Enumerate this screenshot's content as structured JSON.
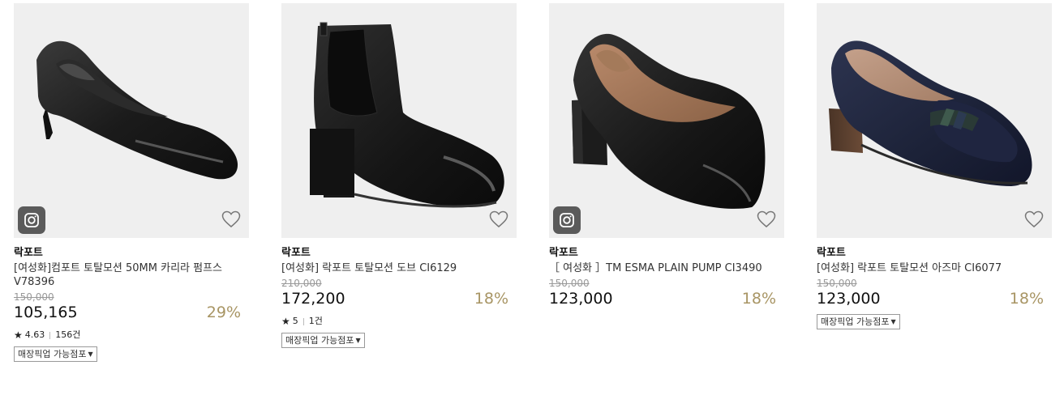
{
  "products": [
    {
      "brand": "락포트",
      "name": "[여성화]컴포트 토탈모션 50MM 카리라 펌프스 V78396",
      "original_price": "150,000",
      "price": "105,165",
      "discount": "29%",
      "rating": "4.63",
      "review_count": "156건",
      "pickup_label": "매장픽업 가능점포",
      "has_insta_badge": true
    },
    {
      "brand": "락포트",
      "name": "[여성화] 락포트 토탈모션 도브 CI6129",
      "original_price": "210,000",
      "price": "172,200",
      "discount": "18%",
      "rating": "5",
      "review_count": "1건",
      "pickup_label": "매장픽업 가능점포",
      "has_insta_badge": false
    },
    {
      "brand": "락포트",
      "name": "［ 여성화 ］TM ESMA PLAIN PUMP CI3490",
      "original_price": "150,000",
      "price": "123,000",
      "discount": "18%",
      "has_insta_badge": true
    },
    {
      "brand": "락포트",
      "name": "[여성화] 락포트 토탈모션 아즈마 CI6077",
      "original_price": "150,000",
      "price": "123,000",
      "discount": "18%",
      "pickup_label": "매장픽업 가능점포",
      "has_insta_badge": false
    }
  ],
  "icons": {
    "insta": "instagram-icon",
    "wish": "heart-outline-icon",
    "star": "star-icon",
    "dropdown": "triangle-down-icon"
  },
  "colors": {
    "discount": "#a89564",
    "image_bg": "#efefef"
  }
}
